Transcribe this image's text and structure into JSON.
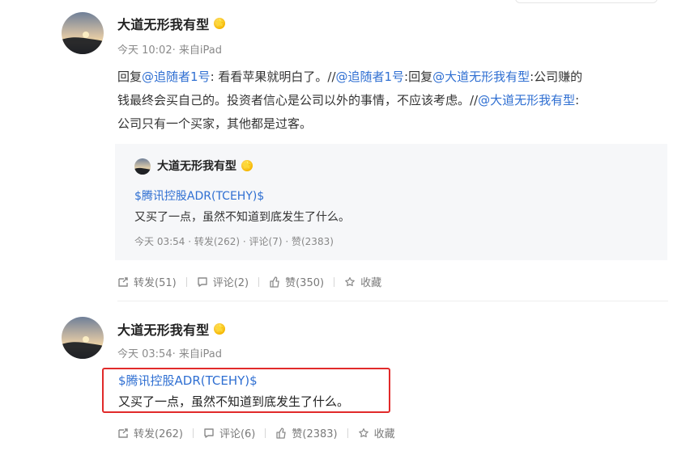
{
  "post1": {
    "author": "大道无形我有型",
    "badge_icon": "verified-badge-icon",
    "meta": "今天 10:02· 来自iPad",
    "lines": [
      [
        {
          "t": "text",
          "v": "回复"
        },
        {
          "t": "mention",
          "v": "@追随者1号"
        },
        {
          "t": "text",
          "v": ": 看看苹果就明白了。//"
        },
        {
          "t": "mention",
          "v": "@追随者1号"
        },
        {
          "t": "text",
          "v": ":回复"
        },
        {
          "t": "mention",
          "v": "@大道无形我有型"
        },
        {
          "t": "text",
          "v": ":公司赚的"
        }
      ],
      [
        {
          "t": "text",
          "v": "钱最终会买自己的。投资者信心是公司以外的事情，不应该考虑。//"
        },
        {
          "t": "mention",
          "v": "@大道无形我有型"
        },
        {
          "t": "text",
          "v": ":"
        }
      ],
      [
        {
          "t": "text",
          "v": "公司只有一个买家，其他都是过客。"
        }
      ]
    ],
    "repost": {
      "author": "大道无形我有型",
      "stock_tag": "$腾讯控股ADR(TCEHY)$",
      "text": "又买了一点，虽然不知道到底发生了什么。",
      "meta": "今天 03:54 · 转发(262) · 评论(7) · 赞(2383)"
    },
    "actions": {
      "forward": "转发(51)",
      "comment": "评论(2)",
      "like": "赞(350)",
      "favorite": "收藏"
    }
  },
  "post2": {
    "author": "大道无形我有型",
    "badge_icon": "verified-badge-icon",
    "meta": "今天 03:54· 来自iPad",
    "stock_tag": "$腾讯控股ADR(TCEHY)$",
    "text": "又买了一点，虽然不知道到底发生了什么。",
    "actions": {
      "forward": "转发(262)",
      "comment": "评论(6)",
      "like": "赞(2383)",
      "favorite": "收藏"
    }
  },
  "colors": {
    "link": "#2f6fd2",
    "highlight_border": "#e12a2a",
    "repost_bg": "#f6f7f9"
  }
}
